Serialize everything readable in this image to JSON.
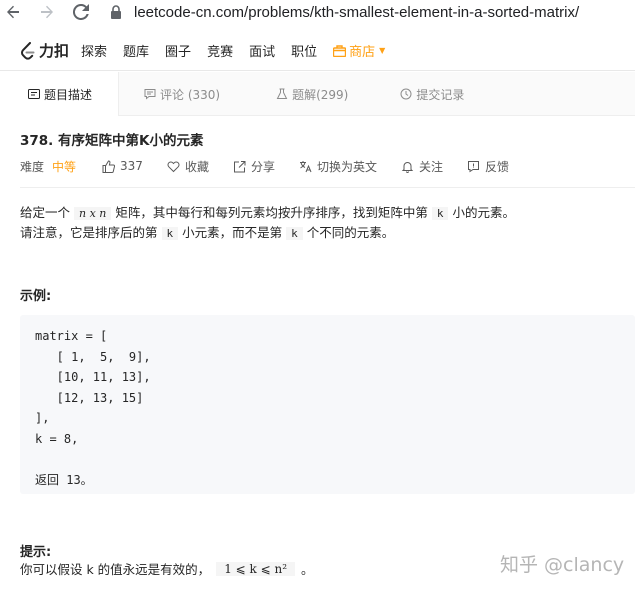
{
  "browser": {
    "url": "leetcode-cn.com/problems/kth-smallest-element-in-a-sorted-matrix/"
  },
  "site_nav": {
    "logo_text": "力扣",
    "links": [
      "探索",
      "题库",
      "圈子",
      "竞赛",
      "面试",
      "职位"
    ],
    "store": "商店",
    "accent_color": "#ffa116"
  },
  "tabs": [
    {
      "label": "题目描述",
      "icon": "description-icon"
    },
    {
      "label": "评论 (330)",
      "icon": "comment-icon"
    },
    {
      "label": "题解(299)",
      "icon": "flask-icon"
    },
    {
      "label": "提交记录",
      "icon": "history-icon"
    }
  ],
  "problem": {
    "title": "378. 有序矩阵中第K小的元素",
    "difficulty_label": "难度",
    "difficulty": "中等",
    "likes": "337",
    "favorite": "收藏",
    "share": "分享",
    "translate": "切换为英文",
    "follow": "关注",
    "feedback": "反馈"
  },
  "description": {
    "line1_pre": "给定一个",
    "line1_math": "n x n",
    "line1_mid": "矩阵，其中每行和每列元素均按升序排序，找到矩阵中第",
    "line1_k": "k",
    "line1_post": "小的元素。",
    "line2_pre": "请注意，它是排序后的第",
    "line2_k": "k",
    "line2_mid": "小元素，而不是第",
    "line2_k2": "k",
    "line2_post": "个不同的元素。"
  },
  "example": {
    "title": "示例:",
    "code": "matrix = [\n   [ 1,  5,  9],\n   [10, 11, 13],\n   [12, 13, 15]\n],\nk = 8,\n\n返回 13。"
  },
  "hint": {
    "title": "提示:",
    "pre": "你可以假设 k 的值永远是有效的，",
    "math": "1 ⩽ k ⩽ n²",
    "post": "。"
  },
  "watermark": "知乎 @clancy"
}
